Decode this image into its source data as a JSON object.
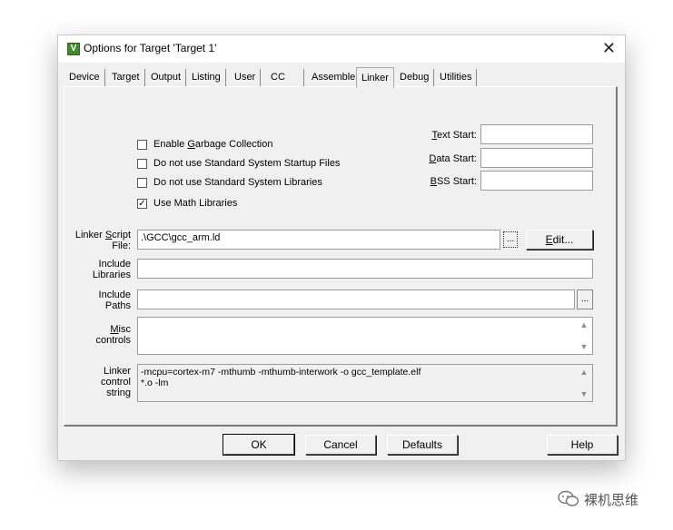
{
  "window": {
    "title": "Options for Target 'Target 1'",
    "icon": "keil-uvision-icon",
    "close_glyph": "✕"
  },
  "tabs": [
    {
      "label": "Device"
    },
    {
      "label": "Target"
    },
    {
      "label": "Output"
    },
    {
      "label": "Listing"
    },
    {
      "label": "User"
    },
    {
      "label": "CC"
    },
    {
      "label": "Assembler"
    },
    {
      "label": "Linker",
      "active": true
    },
    {
      "label": "Debug"
    },
    {
      "label": "Utilities"
    }
  ],
  "options": {
    "garbage": {
      "pre": "Enable ",
      "key": "G",
      "post": "arbage Collection",
      "checked": false
    },
    "startup": {
      "label": "Do not use Standard System Startup Files",
      "checked": false
    },
    "libs": {
      "label": "Do not use Standard System Libraries",
      "checked": false
    },
    "math": {
      "label": "Use Math Libraries",
      "checked": true,
      "mark": "✓"
    }
  },
  "addr": {
    "text": {
      "key": "T",
      "rest": "ext Start:",
      "value": ""
    },
    "data": {
      "key": "D",
      "rest": "ata Start:",
      "value": ""
    },
    "bss": {
      "key": "B",
      "rest": "SS Start:",
      "value": ""
    }
  },
  "script": {
    "label1": "Linker Script",
    "label_key": "S",
    "label1_pre": "Linker ",
    "label1_post": "cript",
    "label2": "File:",
    "value": ".\\GCC\\gcc_arm.ld",
    "edit_key": "E",
    "edit_rest": "dit...",
    "browse": "..."
  },
  "inc_libs": {
    "line1": "Include",
    "line2": "Libraries",
    "value": ""
  },
  "inc_paths": {
    "line1": "Include",
    "line2": "Paths",
    "value": "",
    "browse": "..."
  },
  "misc": {
    "key": "M",
    "line1_rest": "isc",
    "line2": "controls",
    "value": ""
  },
  "ctrl": {
    "line1": "Linker",
    "line2": "control",
    "line3": "string",
    "text1": "-mcpu=cortex-m7 -mthumb -mthumb-interwork -o gcc_template.elf",
    "text2": "*.o -lm"
  },
  "scroll": {
    "up": "▲",
    "down": "▼"
  },
  "buttons": {
    "ok": "OK",
    "cancel": "Cancel",
    "defaults": "Defaults",
    "help": "Help"
  },
  "watermark": {
    "text": "裸机思维",
    "icon": "wechat-icon"
  }
}
